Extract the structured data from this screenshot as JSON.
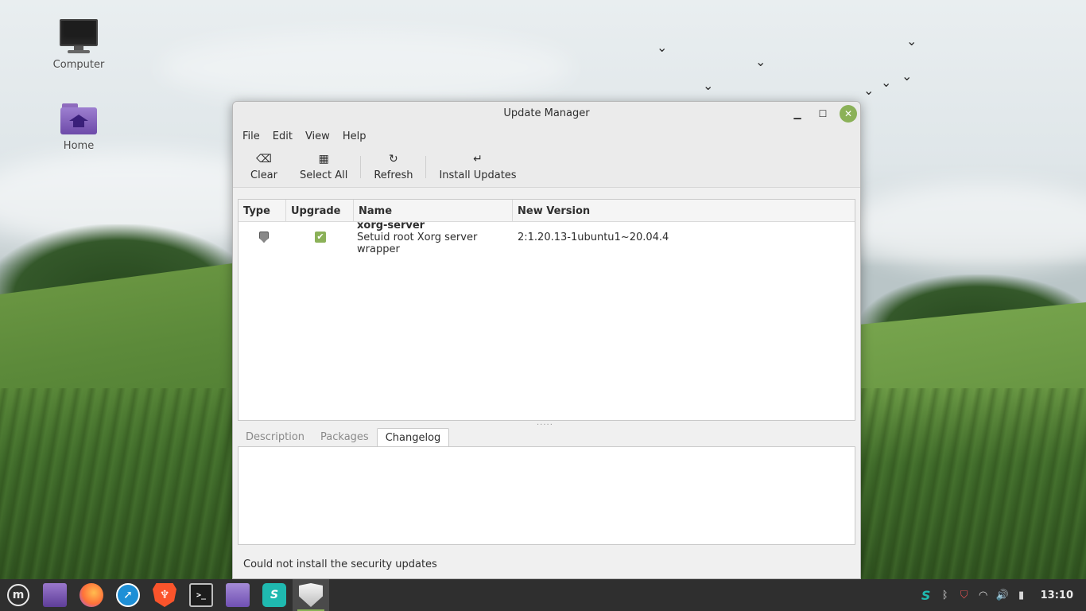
{
  "desktop": {
    "icons": [
      {
        "label": "Computer",
        "icon": "computer-icon"
      },
      {
        "label": "Home",
        "icon": "home-folder-icon"
      }
    ]
  },
  "window": {
    "title": "Update Manager",
    "controls": {
      "minimize": "minimize-icon",
      "maximize": "maximize-icon",
      "close": "close-icon"
    },
    "menu": [
      "File",
      "Edit",
      "View",
      "Help"
    ],
    "toolbar": {
      "clear": {
        "label": "Clear",
        "icon": "clear-icon"
      },
      "select_all": {
        "label": "Select All",
        "icon": "select-all-icon"
      },
      "refresh": {
        "label": "Refresh",
        "icon": "refresh-icon"
      },
      "install": {
        "label": "Install Updates",
        "icon": "install-icon"
      }
    },
    "columns": [
      "Type",
      "Upgrade",
      "Name",
      "New Version"
    ],
    "updates": [
      {
        "type_icon": "security-shield-icon",
        "upgrade": true,
        "name": "xorg-server",
        "description": "Setuid root Xorg server wrapper",
        "new_version": "2:1.20.13-1ubuntu1~20.04.4"
      }
    ],
    "tabs": [
      "Description",
      "Packages",
      "Changelog"
    ],
    "active_tab": "Changelog",
    "status": "Could not install the security updates"
  },
  "taskbar": {
    "apps": [
      {
        "name": "menu",
        "icon": "linux-mint-menu-icon"
      },
      {
        "name": "show-desktop",
        "icon": "show-desktop-icon"
      },
      {
        "name": "firefox",
        "icon": "firefox-icon"
      },
      {
        "name": "compass",
        "icon": "compass-browser-icon"
      },
      {
        "name": "brave",
        "icon": "brave-browser-icon"
      },
      {
        "name": "terminal",
        "icon": "terminal-icon"
      },
      {
        "name": "files",
        "icon": "files-folder-icon"
      },
      {
        "name": "surfshark",
        "icon": "surfshark-icon"
      },
      {
        "name": "update-manager",
        "icon": "update-manager-shield-icon"
      }
    ],
    "tray": [
      "surfshark-tray-icon",
      "bluetooth-icon",
      "security-alert-icon",
      "wifi-icon",
      "volume-icon",
      "battery-icon"
    ],
    "clock": "13:10"
  }
}
